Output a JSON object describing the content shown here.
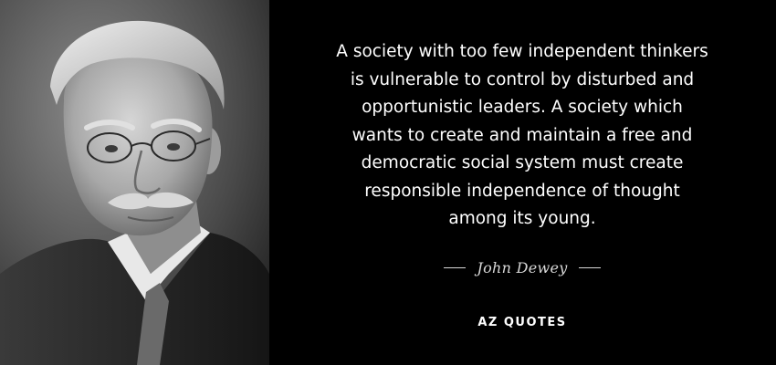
{
  "quote": {
    "lines": [
      "A society with too few independent thinkers",
      "is vulnerable to control by disturbed and",
      "opportunistic leaders. A society which",
      "wants to create and maintain a free and",
      "democratic social system must create",
      "responsible independence of thought",
      "among its young."
    ]
  },
  "author": {
    "name": "John Dewey"
  },
  "brand": {
    "name": "AZ QUOTES"
  },
  "portrait": {
    "icon": "portrait-photo",
    "style": "black-and-white"
  },
  "colors": {
    "background": "#000000",
    "text": "#ffffff",
    "author": "#d8d8d8"
  }
}
